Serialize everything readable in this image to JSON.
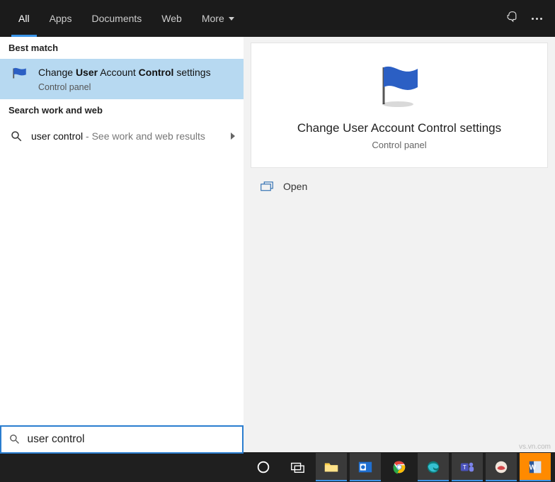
{
  "tabs": {
    "all": "All",
    "apps": "Apps",
    "documents": "Documents",
    "web": "Web",
    "more": "More"
  },
  "left": {
    "best_match_header": "Best match",
    "result_title_pre": "Change ",
    "result_title_b1": "User",
    "result_title_mid": " Account ",
    "result_title_b2": "Control",
    "result_title_post": " settings",
    "result_sub": "Control panel",
    "section2": "Search work and web",
    "sw_query": "user control",
    "sw_suffix": " - See work and web results"
  },
  "preview": {
    "title": "Change User Account Control settings",
    "sub": "Control panel",
    "open": "Open"
  },
  "search": {
    "value": "user control"
  },
  "watermark": "vs.vn.com"
}
